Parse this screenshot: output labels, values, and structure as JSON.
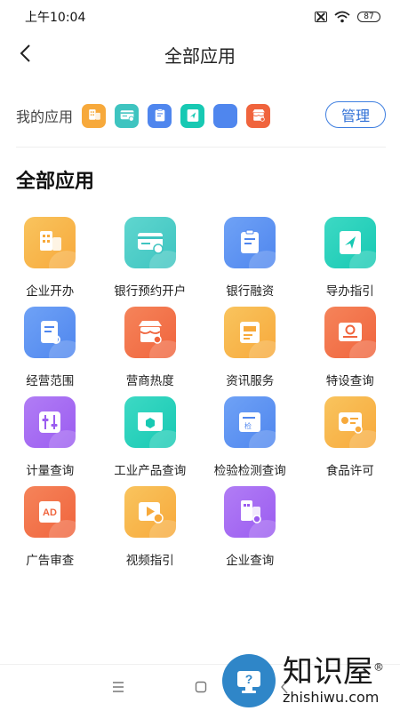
{
  "status_bar": {
    "time": "上午10:04",
    "battery": "87",
    "icons": [
      "sim-off-icon",
      "wifi-icon",
      "battery-icon"
    ]
  },
  "header": {
    "title": "全部应用",
    "back_icon": "chevron-left-icon"
  },
  "my_apps": {
    "label": "我的应用",
    "manage_label": "管理",
    "icons": [
      {
        "name": "enterprise-icon",
        "color": "#f7a93b"
      },
      {
        "name": "bank-card-icon",
        "color": "#3ec4c0"
      },
      {
        "name": "clipboard-icon",
        "color": "#4f86ee"
      },
      {
        "name": "navigation-icon",
        "color": "#17c9b3"
      },
      {
        "name": "document-icon",
        "color": "#4f86ee"
      },
      {
        "name": "store-icon",
        "color": "#f0643d"
      }
    ]
  },
  "section": {
    "title": "全部应用"
  },
  "apps": [
    {
      "label": "企业开办",
      "icon": "enterprise-icon",
      "color": "#f7a93b",
      "color2": "#f9c45e"
    },
    {
      "label": "银行预约开户",
      "icon": "bank-card-icon",
      "color": "#3ec4c0",
      "color2": "#5fd6cf"
    },
    {
      "label": "银行融资",
      "icon": "clipboard-icon",
      "color": "#4f86ee",
      "color2": "#6fa2f6"
    },
    {
      "label": "导办指引",
      "icon": "navigation-icon",
      "color": "#17c9b3",
      "color2": "#3dd9c4"
    },
    {
      "label": "经营范围",
      "icon": "document-search-icon",
      "color": "#4f86ee",
      "color2": "#6fa2f6"
    },
    {
      "label": "营商热度",
      "icon": "store-icon",
      "color": "#f0643d",
      "color2": "#f5845a"
    },
    {
      "label": "资讯服务",
      "icon": "news-icon",
      "color": "#f7a93b",
      "color2": "#f9c45e"
    },
    {
      "label": "特设查询",
      "icon": "search-card-icon",
      "color": "#f0643d",
      "color2": "#f5845a"
    },
    {
      "label": "计量查询",
      "icon": "slider-icon",
      "color": "#9b5cf0",
      "color2": "#b17df5"
    },
    {
      "label": "工业产品查询",
      "icon": "product-icon",
      "color": "#17c9b3",
      "color2": "#3dd9c4"
    },
    {
      "label": "检验检测查询",
      "icon": "inspection-icon",
      "color": "#4f86ee",
      "color2": "#6fa2f6"
    },
    {
      "label": "食品许可",
      "icon": "food-license-icon",
      "color": "#f7a93b",
      "color2": "#f9c45e"
    },
    {
      "label": "广告审查",
      "icon": "ad-icon",
      "color": "#f0643d",
      "color2": "#f5845a"
    },
    {
      "label": "视频指引",
      "icon": "video-icon",
      "color": "#f7a93b",
      "color2": "#f9c45e"
    },
    {
      "label": "企业查询",
      "icon": "enterprise-search-icon",
      "color": "#9b5cf0",
      "color2": "#b17df5"
    }
  ],
  "nav_bar": {
    "icons": [
      "menu-icon",
      "home-icon",
      "back-icon"
    ]
  },
  "watermark": {
    "title": "知识屋",
    "subtitle": "zhishiwu.com",
    "mark": "®"
  }
}
